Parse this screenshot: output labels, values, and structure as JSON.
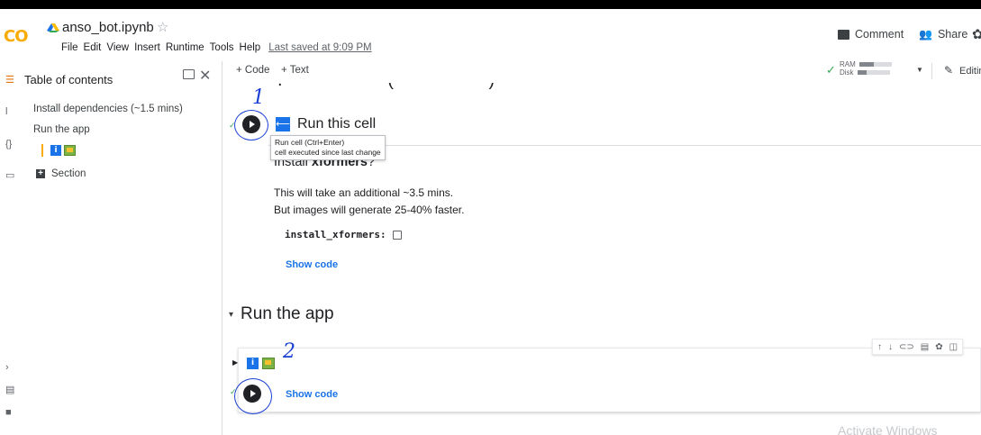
{
  "header": {
    "logo": "CO",
    "notebook_title": "anso_bot.ipynb",
    "menu": [
      "File",
      "Edit",
      "View",
      "Insert",
      "Runtime",
      "Tools",
      "Help"
    ],
    "last_saved": "Last saved at 9:09 PM",
    "comment_label": "Comment",
    "share_label": "Share"
  },
  "sidebar": {
    "title": "Table of contents",
    "items": [
      {
        "label": "Install dependencies (~1.5 mins)"
      },
      {
        "label": "Run the app"
      }
    ],
    "section_label": "Section"
  },
  "toolbar": {
    "add_code": "+ Code",
    "add_text": "+ Text",
    "ram_label": "RAM",
    "disk_label": "Disk",
    "ram_usage": 0.45,
    "disk_usage": 0.3,
    "editing_label": "Editin"
  },
  "cells": {
    "run_this_cell": "Run this cell",
    "tooltip_line1": "Run cell (Ctrl+Enter)",
    "tooltip_line2": "cell executed since last change",
    "install_heading_prefix": "Install ",
    "install_heading_bold": "xformers",
    "install_heading_suffix": "?",
    "line1": "This will take an additional ~3.5 mins.",
    "line2": "But images will generate 25-40% faster.",
    "form_field": "install_xformers:",
    "show_code": "Show code",
    "section_title": "Run the app",
    "show_code_2": "Show code"
  },
  "annotations": {
    "one": "1",
    "two": "2"
  },
  "watermark": "Activate Windows"
}
